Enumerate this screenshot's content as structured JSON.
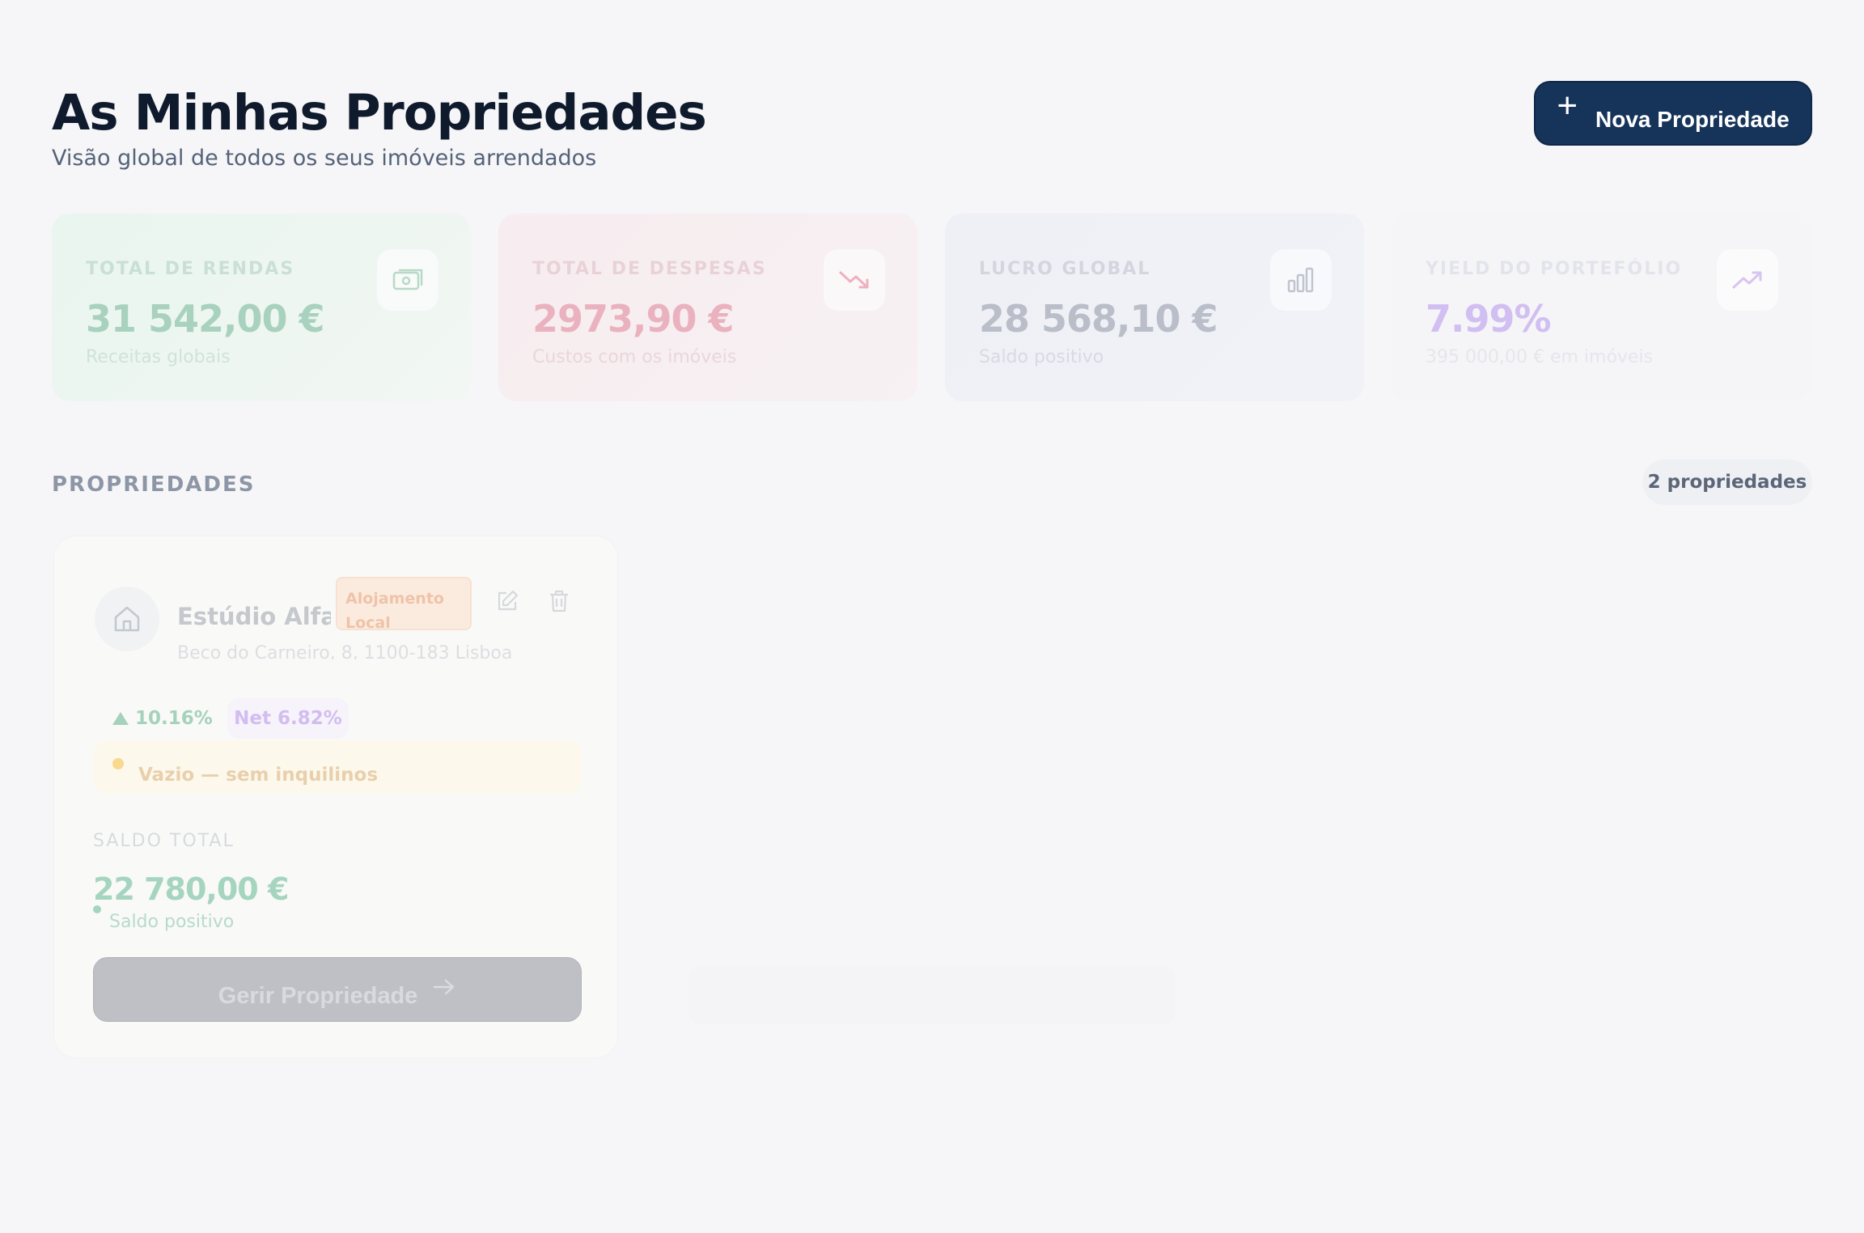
{
  "header": {
    "title": "As Minhas Propriedades",
    "subtitle": "Visão global de todos os seus imóveis arrendados",
    "new_button": "Nova Propriedade"
  },
  "stats": [
    {
      "label": "TOTAL DE RENDAS",
      "value": "31 542,00 €",
      "sub": "Receitas globais",
      "icon": "banknote-icon",
      "color": "#a8d2bd"
    },
    {
      "label": "TOTAL DE DESPESAS",
      "value": "2973,90 €",
      "sub": "Custos com os imóveis",
      "icon": "trending-down-icon",
      "color": "#eab2bf"
    },
    {
      "label": "LUCRO GLOBAL",
      "value": "28 568,10 €",
      "sub": "Saldo positivo",
      "icon": "bar-chart-icon",
      "color": "#b9bec9"
    },
    {
      "label": "YIELD DO PORTEFÓLIO",
      "value": "7.99%",
      "sub": "395 000,00 € em imóveis",
      "icon": "trending-up-icon",
      "color": "#d2bff2"
    }
  ],
  "section": {
    "title": "PROPRIEDADES",
    "count": "2 propriedades"
  },
  "property": {
    "name": "Estúdio Alfama",
    "address": "Beco do Carneiro, 8, 1100-183 Lisboa",
    "tag": "Alojamento Local",
    "gross_yield": "10.16%",
    "net_yield": "Net 6.82%",
    "status": "Vazio — sem inquilinos",
    "balance_label": "SALDO TOTAL",
    "balance_value": "22 780,00 €",
    "balance_sub": "Saldo positivo",
    "manage_button": "Gerir Propriedade"
  }
}
